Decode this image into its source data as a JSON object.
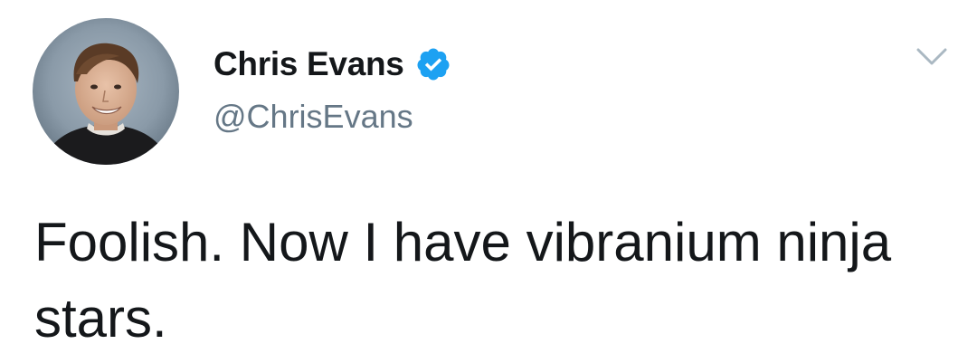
{
  "tweet": {
    "author": {
      "display_name": "Chris Evans",
      "handle": "@ChrisEvans",
      "verified": true,
      "avatar_icon": "profile-photo"
    },
    "text": "Foolish. Now I have vibranium ninja stars.",
    "menu_icon": "chevron-down-icon"
  },
  "colors": {
    "text": "#14171a",
    "handle": "#657786",
    "verified_blue": "#1da1f2",
    "chevron": "#aab8c2",
    "background": "#ffffff"
  }
}
